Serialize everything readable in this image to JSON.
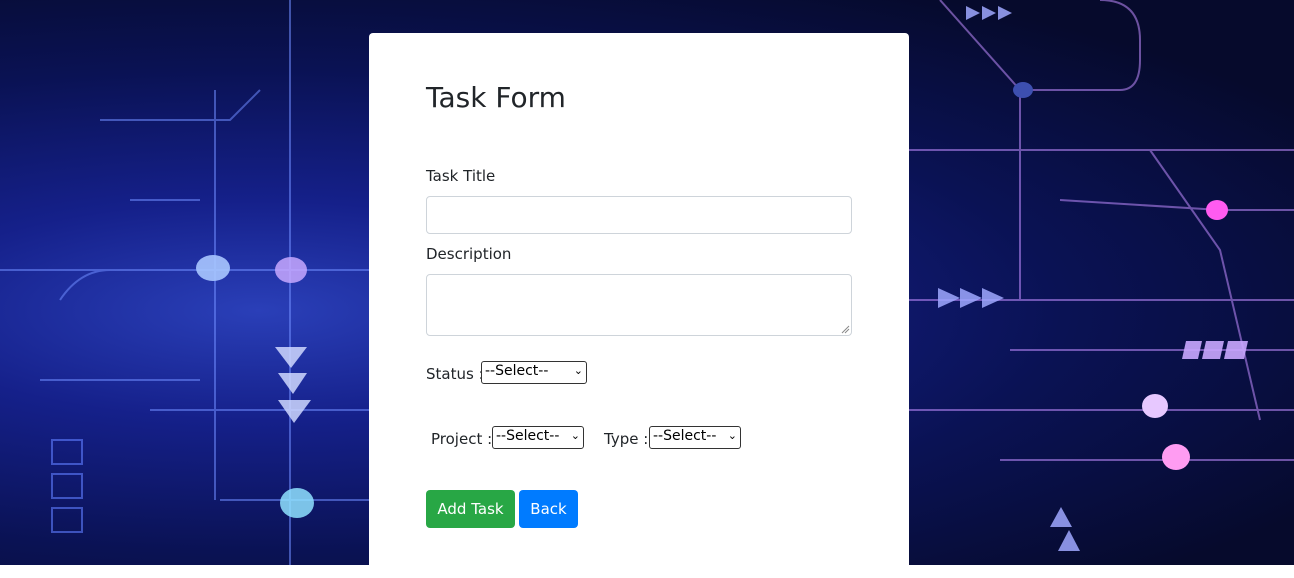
{
  "form": {
    "title": "Task Form",
    "task_title_label": "Task Title",
    "task_title_value": "",
    "description_label": "Description",
    "description_value": "",
    "status_label": "Status :",
    "status_selected": "--Select--",
    "project_label": "Project :",
    "project_selected": "--Select--",
    "type_label": "Type :",
    "type_selected": "--Select--",
    "add_button_label": "Add Task",
    "back_button_label": "Back"
  },
  "colors": {
    "add_button": "#28a745",
    "back_button": "#007bff",
    "background_dark": "#0a1254"
  },
  "icons": {
    "select_chevron": "chevron-down-icon"
  }
}
